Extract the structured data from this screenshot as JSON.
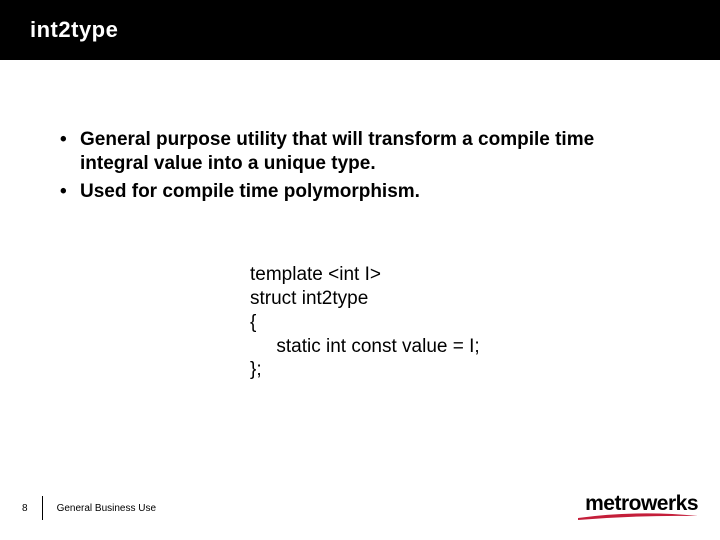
{
  "title": "int2type",
  "bullets": [
    "General purpose utility that will transform a compile time integral value into a unique type.",
    "Used for compile time polymorphism."
  ],
  "code": {
    "l1": "template <int I>",
    "l2": "struct int2type",
    "l3": "{",
    "l4": "     static int const value = I;",
    "l5": "};"
  },
  "footer": {
    "page": "8",
    "label": "General Business Use"
  },
  "brand": "metrowerks"
}
